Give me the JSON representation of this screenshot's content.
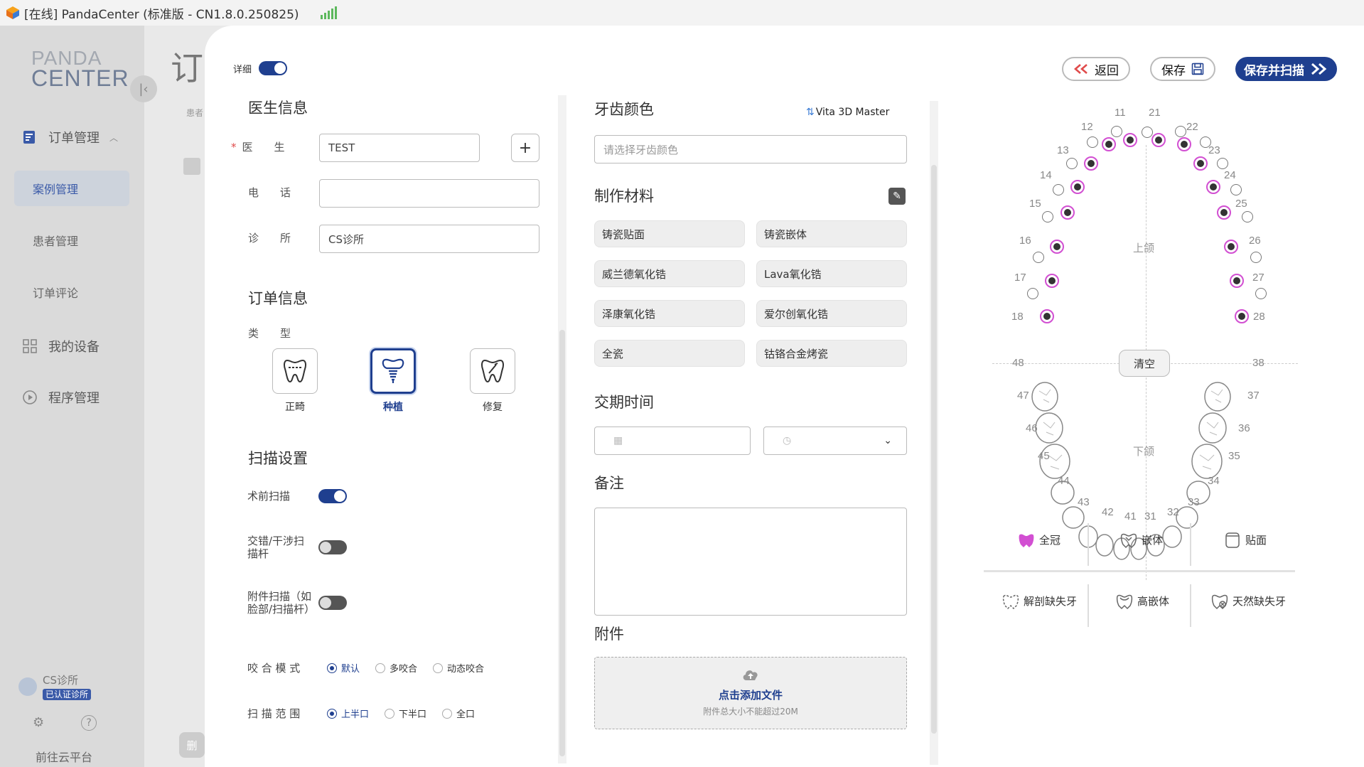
{
  "titlebar": {
    "title": "[在线] PandaCenter (标准版 - CN1.8.0.250825)"
  },
  "sidebar": {
    "logo_line1": "PANDA",
    "logo_line2": "CENTER",
    "order_mgmt": "订单管理",
    "case_mgmt": "案例管理",
    "patient_mgmt": "患者管理",
    "order_review": "订单评论",
    "my_devices": "我的设备",
    "program_mgmt": "程序管理",
    "clinic_name": "CS诊所",
    "clinic_badge": "已认证诊所",
    "cloud_link": "前往云平台"
  },
  "background": {
    "title_char": "订",
    "patient_hint": "患者",
    "delete_hint": "删"
  },
  "modal": {
    "detail_label": "详细",
    "buttons": {
      "back": "返回",
      "save": "保存",
      "save_scan": "保存并扫描"
    },
    "doctor": {
      "title": "医生信息",
      "doctor_label": "医　　生",
      "doctor_value": "TEST",
      "phone_label": "电　　话",
      "phone_value": "",
      "clinic_label": "诊　　所",
      "clinic_value": "CS诊所"
    },
    "order": {
      "title": "订单信息",
      "type_label": "类　　型",
      "types": [
        "正畸",
        "种植",
        "修复"
      ],
      "selected_type": "种植"
    },
    "scan": {
      "title": "扫描设置",
      "preop": "术前扫描",
      "cross": "交错/干涉扫描杆",
      "attach": "附件扫描（如脸部/扫描杆）",
      "bite_label": "咬 合 模 式",
      "bite_options": [
        "默认",
        "多咬合",
        "动态咬合"
      ],
      "range_label": "扫 描 范 围",
      "range_options": [
        "上半口",
        "下半口",
        "全口"
      ]
    },
    "shade": {
      "title": "牙齿颜色",
      "system": "Vita 3D Master",
      "placeholder": "请选择牙齿颜色"
    },
    "material": {
      "title": "制作材料",
      "items": [
        "铸瓷贴面",
        "铸瓷嵌体",
        "威兰德氧化锆",
        "Lava氧化锆",
        "泽康氧化锆",
        "爱尔创氧化锆",
        "全瓷",
        "钴铬合金烤瓷"
      ]
    },
    "delivery": {
      "title": "交期时间"
    },
    "notes": {
      "title": "备注"
    },
    "attachment": {
      "title": "附件",
      "upload": "点击添加文件",
      "limit": "附件总大小不能超过20M"
    },
    "teeth": {
      "upper_label": "上颌",
      "lower_label": "下颌",
      "clear": "清空",
      "upper_numbers": [
        "11",
        "12",
        "13",
        "14",
        "15",
        "16",
        "17",
        "18",
        "21",
        "22",
        "23",
        "24",
        "25",
        "26",
        "27",
        "28"
      ],
      "lower_numbers": [
        "31",
        "32",
        "33",
        "34",
        "35",
        "36",
        "37",
        "38",
        "41",
        "42",
        "43",
        "44",
        "45",
        "46",
        "47",
        "48"
      ]
    },
    "restorations": [
      "全冠",
      "嵌体",
      "贴面",
      "解剖缺失牙",
      "高嵌体",
      "天然缺失牙"
    ],
    "colors": {
      "accent": "#1f3f8f",
      "selected_ring": "#d24fd2",
      "required": "#e04b4b"
    }
  }
}
